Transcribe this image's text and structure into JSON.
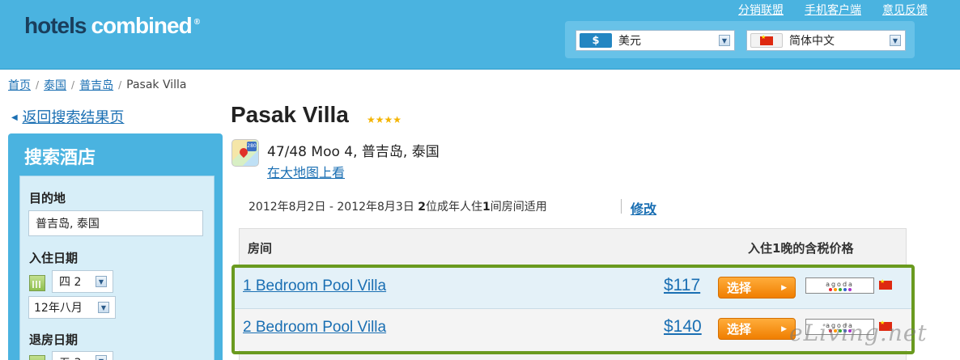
{
  "header": {
    "logo_dark": "hotels",
    "logo_light": "combined",
    "logo_reg": "®",
    "links": [
      "分销联盟",
      "手机客户端",
      "意见反馈"
    ],
    "currency": {
      "symbol": "$",
      "value": "美元"
    },
    "language": {
      "value": "简体中文"
    }
  },
  "breadcrumb": {
    "items": [
      "首页",
      "泰国",
      "普吉岛"
    ],
    "current": "Pasak Villa",
    "sep": "/"
  },
  "sidebar": {
    "back_label": "返回搜索结果页",
    "title": "搜索酒店",
    "destination_label": "目的地",
    "destination_value": "普吉岛, 泰国",
    "checkin_label": "入住日期",
    "checkin_day": "四 2",
    "checkin_month": "12年八月",
    "checkout_label": "退房日期",
    "checkout_day": "五 3"
  },
  "hotel": {
    "name": "Pasak Villa",
    "stars": "★★★★",
    "star_rating": 4,
    "address": "47/48 Moo 4, 普吉岛, 泰国",
    "map_link": "在大地图上看"
  },
  "search_summary": {
    "dates_prefix": "2012年8月2日 - 2012年8月3日 ",
    "guests": "2",
    "guests_suffix": "位成年人住",
    "rooms": "1",
    "rooms_suffix": "间房间适用",
    "modify_label": "修改"
  },
  "table": {
    "col_room": "房间",
    "col_price": "入住1晚的含税价格",
    "rows": [
      {
        "room": "1 Bedroom Pool Villa",
        "price": "$117",
        "button": "选择",
        "provider": "agoda"
      },
      {
        "room": "2 Bedroom Pool Villa",
        "price": "$140",
        "button": "选择",
        "provider": "agoda"
      }
    ]
  },
  "watermark": "eLiving.net",
  "colors": {
    "header_bg": "#4ab3e0",
    "link": "#1a6fb3",
    "highlight_border": "#6a9a1f",
    "button": "#f58a00"
  }
}
